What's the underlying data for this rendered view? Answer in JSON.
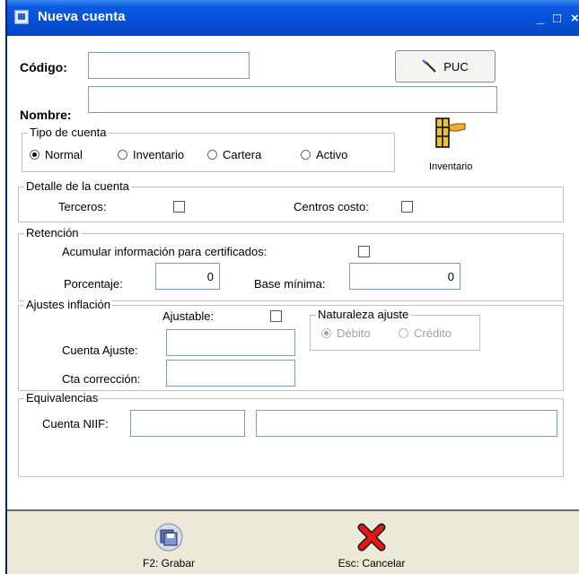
{
  "window": {
    "title": "Nueva cuenta",
    "controls": {
      "minimize": "_",
      "maximize": "□",
      "close": "×"
    }
  },
  "codigo": {
    "label": "Código:",
    "value": ""
  },
  "nombre": {
    "label": "Nombre:",
    "value": ""
  },
  "puc_button": {
    "label": "PUC",
    "icon": "wand-icon"
  },
  "tipo_cuenta": {
    "legend": "Tipo de cuenta",
    "options": [
      {
        "label": "Normal",
        "selected": true
      },
      {
        "label": "Inventario",
        "selected": false
      },
      {
        "label": "Cartera",
        "selected": false
      },
      {
        "label": "Activo",
        "selected": false
      }
    ],
    "indicator": {
      "label": "Inventario",
      "icon": "inventory-hand-icon"
    }
  },
  "detalle": {
    "legend": "Detalle de la cuenta",
    "terceros": "Terceros:",
    "centros": "Centros costo:"
  },
  "retencion": {
    "legend": "Retención",
    "acumular": "Acumular información para certificados:",
    "porcentaje_label": "Porcentaje:",
    "porcentaje_value": "0",
    "base_label": "Base mínima:",
    "base_value": "0"
  },
  "ajustes": {
    "legend": "Ajustes inflación",
    "ajustable": "Ajustable:",
    "cuenta_ajuste_label": "Cuenta Ajuste:",
    "cuenta_ajuste_value": "",
    "cta_correccion_label": "Cta corrección:",
    "cta_correccion_value": "",
    "naturaleza": {
      "legend": "Naturaleza ajuste",
      "options": [
        {
          "label": "Débito",
          "selected": true
        },
        {
          "label": "Crédito",
          "selected": false
        }
      ]
    }
  },
  "equivalencias": {
    "legend": "Equivalencias",
    "cuenta_niif_label": "Cuenta NIIF:",
    "code_value": "",
    "name_value": ""
  },
  "toolbar": {
    "save": {
      "label": "F2: Grabar",
      "icon": "save-disk-icon"
    },
    "cancel": {
      "label": "Esc: Cancelar",
      "icon": "cancel-x-icon"
    }
  }
}
